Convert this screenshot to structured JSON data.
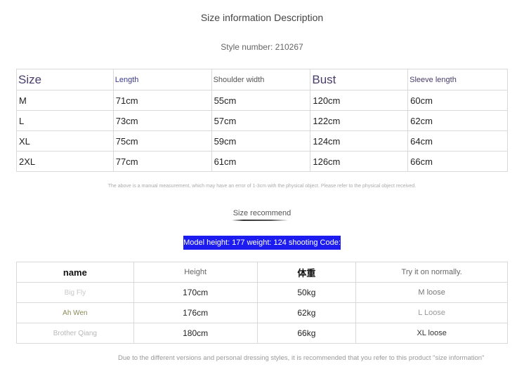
{
  "title": "Size information Description",
  "style_number": "Style number: 210267",
  "size_table": {
    "headers": [
      "Size",
      "Length",
      "Shoulder width",
      "Bust",
      "Sleeve length"
    ],
    "rows": [
      [
        "M",
        "71cm",
        "55cm",
        "120cm",
        "60cm"
      ],
      [
        "L",
        "73cm",
        "57cm",
        "122cm",
        "62cm"
      ],
      [
        "XL",
        "75cm",
        "59cm",
        "124cm",
        "64cm"
      ],
      [
        "2XL",
        "77cm",
        "61cm",
        "126cm",
        "66cm"
      ]
    ]
  },
  "note": "The above is a manual measurement, which may have an error of 1-3cm with the physical object. Please refer to the physical object received.",
  "recommend_title": "Size recommend",
  "model_banner": "Model height: 177 weight: 124 shooting Code:",
  "model_table": {
    "headers": [
      "name",
      "Height",
      "体重",
      "Try it on normally."
    ],
    "rows": [
      [
        "Big Fly",
        "170cm",
        "50kg",
        "M loose"
      ],
      [
        "Ah Wen",
        "176cm",
        "62kg",
        "L Loose"
      ],
      [
        "Brother Qiang",
        "180cm",
        "66kg",
        "XL loose"
      ]
    ]
  },
  "footer": "Due to the different versions and personal dressing styles, it is recommended that you refer to this product \"size information\""
}
